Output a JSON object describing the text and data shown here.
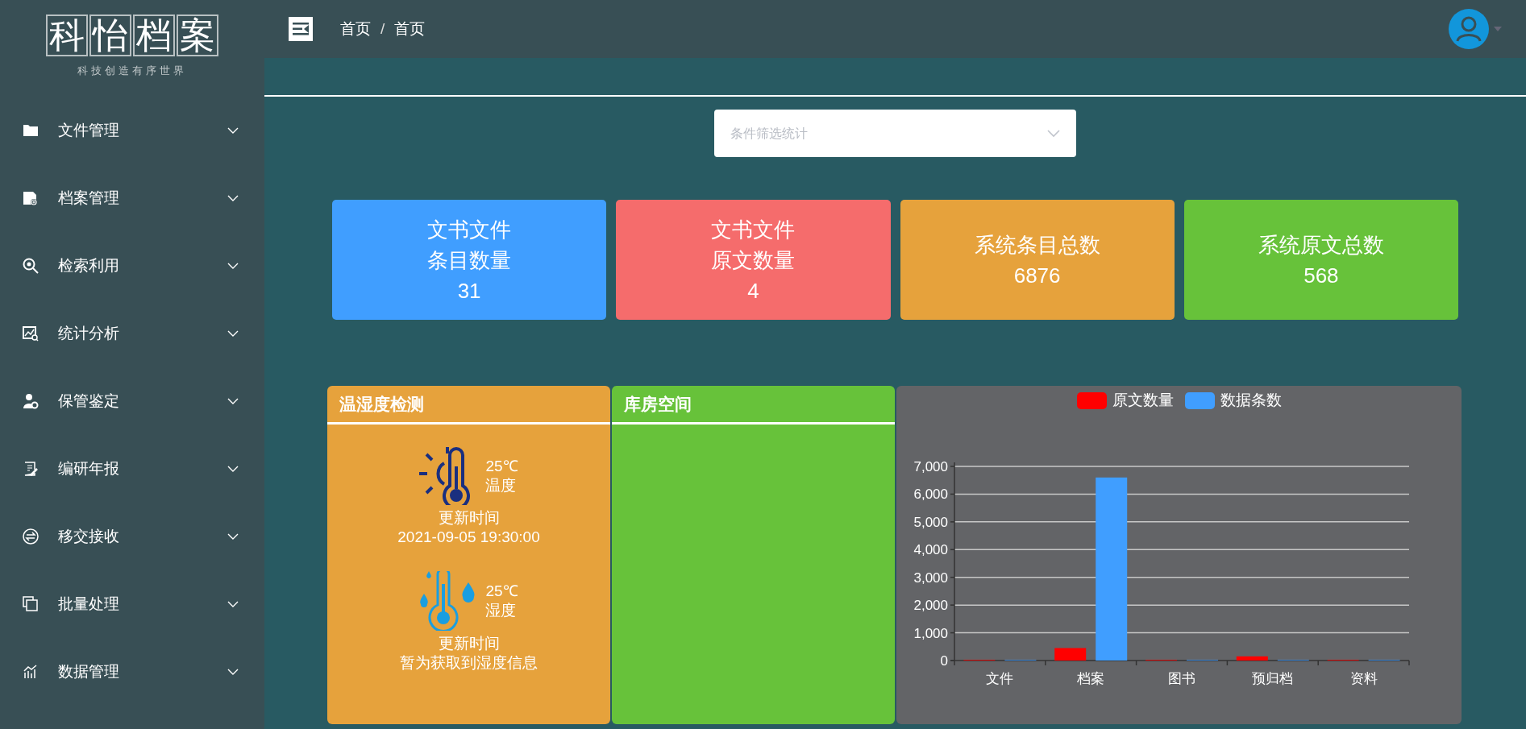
{
  "logo": {
    "title": [
      "科",
      "怡",
      "档",
      "案"
    ],
    "subtitle": "科技创造有序世界"
  },
  "sidebar": {
    "items": [
      {
        "label": "文件管理",
        "expanded": false
      },
      {
        "label": "档案管理",
        "expanded": false
      },
      {
        "label": "检索利用",
        "expanded": false
      },
      {
        "label": "统计分析",
        "expanded": false
      },
      {
        "label": "保管鉴定",
        "expanded": false
      },
      {
        "label": "编研年报",
        "expanded": false
      },
      {
        "label": "移交接收",
        "expanded": false
      },
      {
        "label": "批量处理",
        "expanded": false
      },
      {
        "label": "数据管理",
        "expanded": false
      }
    ]
  },
  "breadcrumb": [
    "首页",
    "首页"
  ],
  "breadcrumb_separator": "/",
  "filter": {
    "placeholder": "条件筛选统计"
  },
  "stat_cards": [
    {
      "lines": [
        "文书文件",
        "条目数量",
        "31"
      ],
      "color": "#409eff"
    },
    {
      "lines": [
        "文书文件",
        "原文数量",
        "4"
      ],
      "color": "#f56c6c"
    },
    {
      "lines": [
        "系统条目总数",
        "6876"
      ],
      "color": "#e6a23c"
    },
    {
      "lines": [
        "系统原文总数",
        "568"
      ],
      "color": "#67c23a"
    }
  ],
  "humidity_panel": {
    "title": "温湿度检测",
    "sensors": [
      {
        "kind": "temperature",
        "value": "25℃",
        "label": "温度",
        "update_label": "更新时间",
        "update_value": "2021-09-05 19:30:00"
      },
      {
        "kind": "humidity",
        "value": "25℃",
        "label": "湿度",
        "update_label": "更新时间",
        "update_value": "暂为获取到湿度信息"
      }
    ]
  },
  "storage_panel": {
    "title": "库房空间"
  },
  "chart_panel": {
    "chart_data": {
      "type": "bar",
      "categories": [
        "文件",
        "档案",
        "图书",
        "预归档",
        "资料"
      ],
      "series": [
        {
          "name": "原文数量",
          "color": "#ff0000",
          "values": [
            0,
            450,
            0,
            150,
            0
          ]
        },
        {
          "name": "数据条数",
          "color": "#409eff",
          "values": [
            0,
            6600,
            0,
            0,
            0
          ]
        }
      ],
      "ylim": [
        0,
        7000
      ],
      "grid": true,
      "legend": true,
      "yticks": [
        {
          "value": 0,
          "label": "0"
        },
        {
          "value": 1000,
          "label": "1,000"
        },
        {
          "value": 2000,
          "label": "2,000"
        },
        {
          "value": 3000,
          "label": "3,000"
        },
        {
          "value": 4000,
          "label": "4,000"
        },
        {
          "value": 5000,
          "label": "5,000"
        },
        {
          "value": 6000,
          "label": "6,000"
        },
        {
          "value": 7000,
          "label": "7,000"
        }
      ]
    }
  }
}
